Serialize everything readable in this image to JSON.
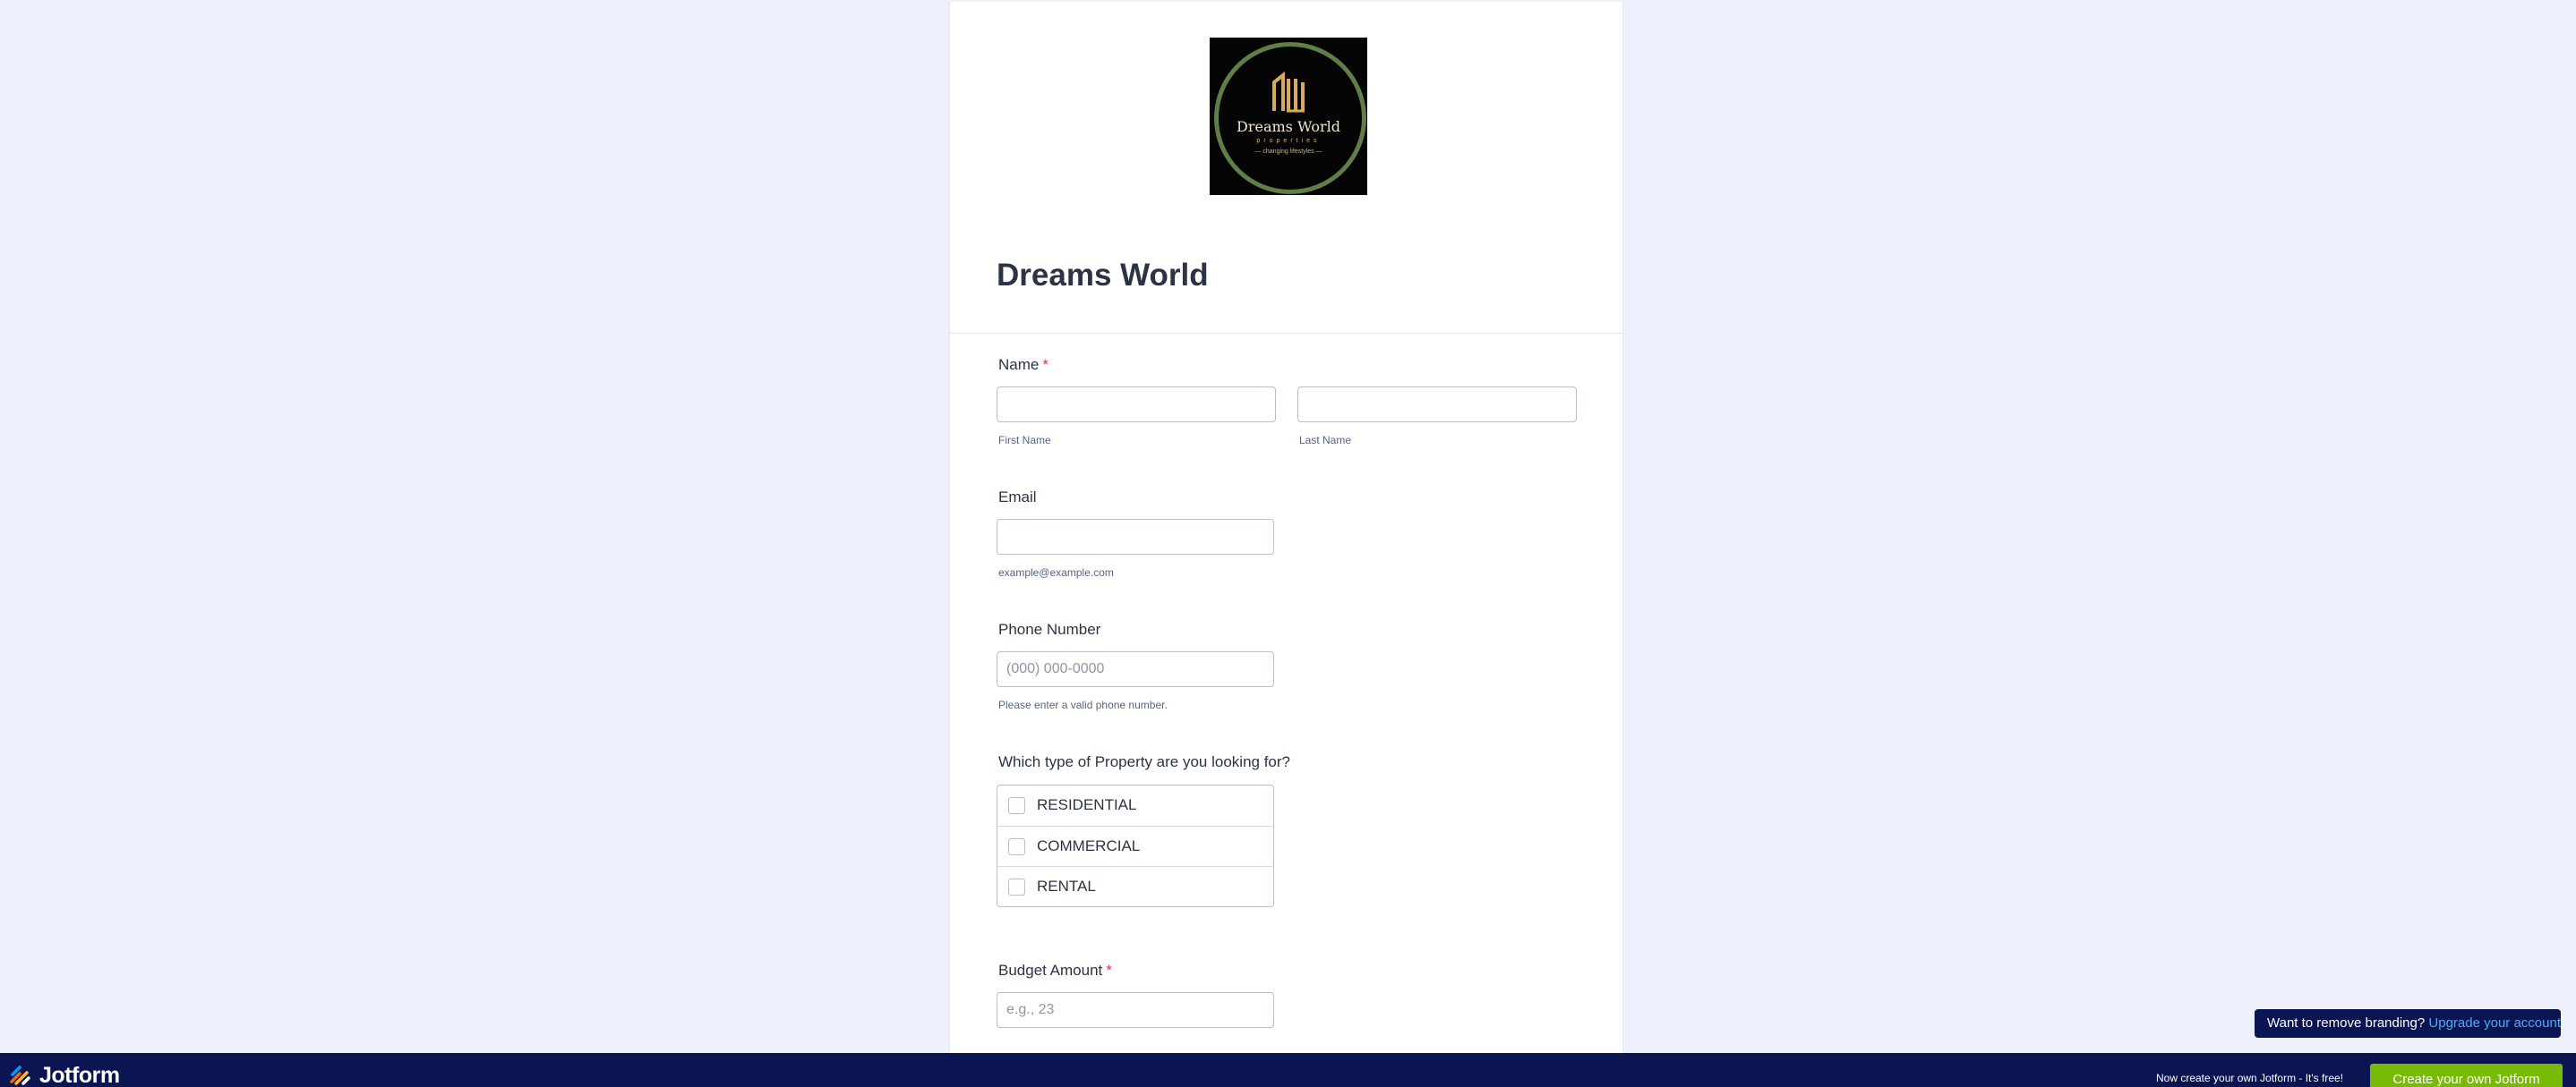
{
  "logo": {
    "title": "Dreams World",
    "subtitle": "properties",
    "tagline": "— changing lifestyles —",
    "colors": {
      "background": "#050505",
      "ring": "#5f7f46",
      "gold": "#d9a95c"
    }
  },
  "form": {
    "title": "Dreams World",
    "name": {
      "label": "Name",
      "required": "*",
      "first_sublabel": "First Name",
      "last_sublabel": "Last Name"
    },
    "email": {
      "label": "Email",
      "sublabel": "example@example.com"
    },
    "phone": {
      "label": "Phone Number",
      "placeholder": "(000) 000-0000",
      "sublabel": "Please enter a valid phone number."
    },
    "property": {
      "label": "Which type of Property are you looking for?",
      "options": [
        "RESIDENTIAL",
        "COMMERCIAL",
        "RENTAL"
      ]
    },
    "budget": {
      "label": "Budget Amount",
      "required": "*",
      "placeholder": "e.g., 23"
    }
  },
  "branding": {
    "text": "Want to remove branding?",
    "link": "Upgrade your account"
  },
  "footer": {
    "brand": "Jotform",
    "text": "Now create your own Jotform - It's free!",
    "cta": "Create your own Jotform",
    "colors": {
      "bar": "#0a1551",
      "cta": "#78bb07"
    }
  }
}
